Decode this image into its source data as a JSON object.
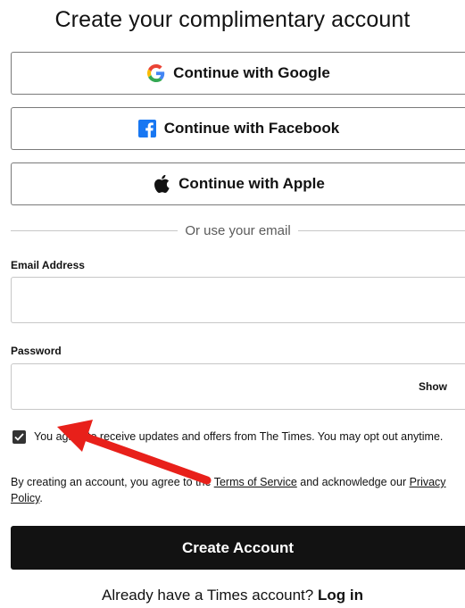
{
  "header": {
    "title": "Create your complimentary account"
  },
  "social": {
    "google": {
      "label": "Continue with Google",
      "icon": "google-icon"
    },
    "facebook": {
      "label": "Continue with Facebook",
      "icon": "facebook-icon"
    },
    "apple": {
      "label": "Continue with Apple",
      "icon": "apple-icon"
    }
  },
  "divider": {
    "text": "Or use your email"
  },
  "form": {
    "email_label": "Email Address",
    "email_value": "",
    "password_label": "Password",
    "password_value": "",
    "show_label": "Show"
  },
  "consent": {
    "checked": true,
    "text": "You agree to receive updates and offers from The Times. You may opt out anytime."
  },
  "legal": {
    "prefix": "By creating an account, you agree to the ",
    "terms_link": "Terms of Service",
    "middle": " and acknowledge our ",
    "privacy_link": "Privacy Policy",
    "suffix": "."
  },
  "actions": {
    "create_label": "Create Account"
  },
  "footer": {
    "prompt": "Already have a Times account? ",
    "login_link": "Log in"
  },
  "colors": {
    "google_blue": "#4285F4",
    "google_red": "#EA4335",
    "google_yellow": "#FBBC05",
    "google_green": "#34A853",
    "facebook_blue": "#1877F2",
    "primary_dark": "#121212",
    "annotation_arrow": "#e8201a"
  }
}
